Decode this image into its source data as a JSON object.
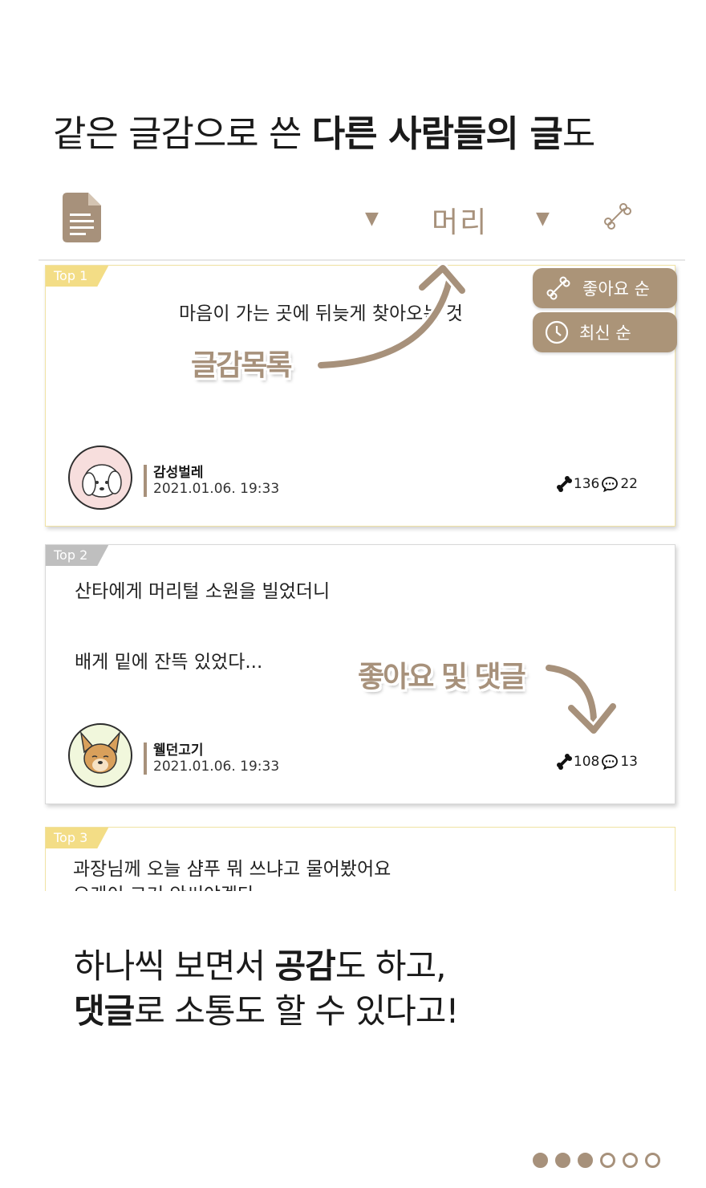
{
  "headline": {
    "part1": "같은 글감으로 쓴 ",
    "bold": "다른 사람들의 글",
    "part2": "도"
  },
  "toolbar": {
    "topic": "머리",
    "arrow": "▼"
  },
  "sort_menu": {
    "likes_label": "좋아요 순",
    "latest_label": "최신 순"
  },
  "posts": [
    {
      "rank": "Top 1",
      "lines": [
        "마음이 가는 곳에 뒤늦게 찾아오는 것"
      ],
      "author": "감성벌레",
      "date": "2021.01.06. 19:33",
      "likes": "136",
      "comments": "22"
    },
    {
      "rank": "Top 2",
      "lines": [
        "산타에게 머리털 소원을 빌었더니",
        "배게 밑에 잔뜩 있었다..."
      ],
      "author": "웰던고기",
      "date": "2021.01.06. 19:33",
      "likes": "108",
      "comments": "13"
    },
    {
      "rank": "Top 3",
      "lines": [
        "과장님께 오늘 샴푸 뭐 쓰냐고 물어봤어요",
        "오케이  그거 안써야겠다"
      ]
    }
  ],
  "callouts": {
    "topic_list": "글감목록",
    "likes_comments": "좋아요 및 댓글"
  },
  "caption": {
    "line1_a": "하나씩 보면서 ",
    "line1_b": "공감",
    "line1_c": "도 하고,",
    "line2_a": "댓글",
    "line2_b": "로 소통도 할 수 있다고!"
  },
  "pagination": {
    "total": 6,
    "current_filled": 3
  },
  "colors": {
    "accent": "#a7917b",
    "gold": "#f3dd86",
    "silver": "#bfbfbf"
  }
}
